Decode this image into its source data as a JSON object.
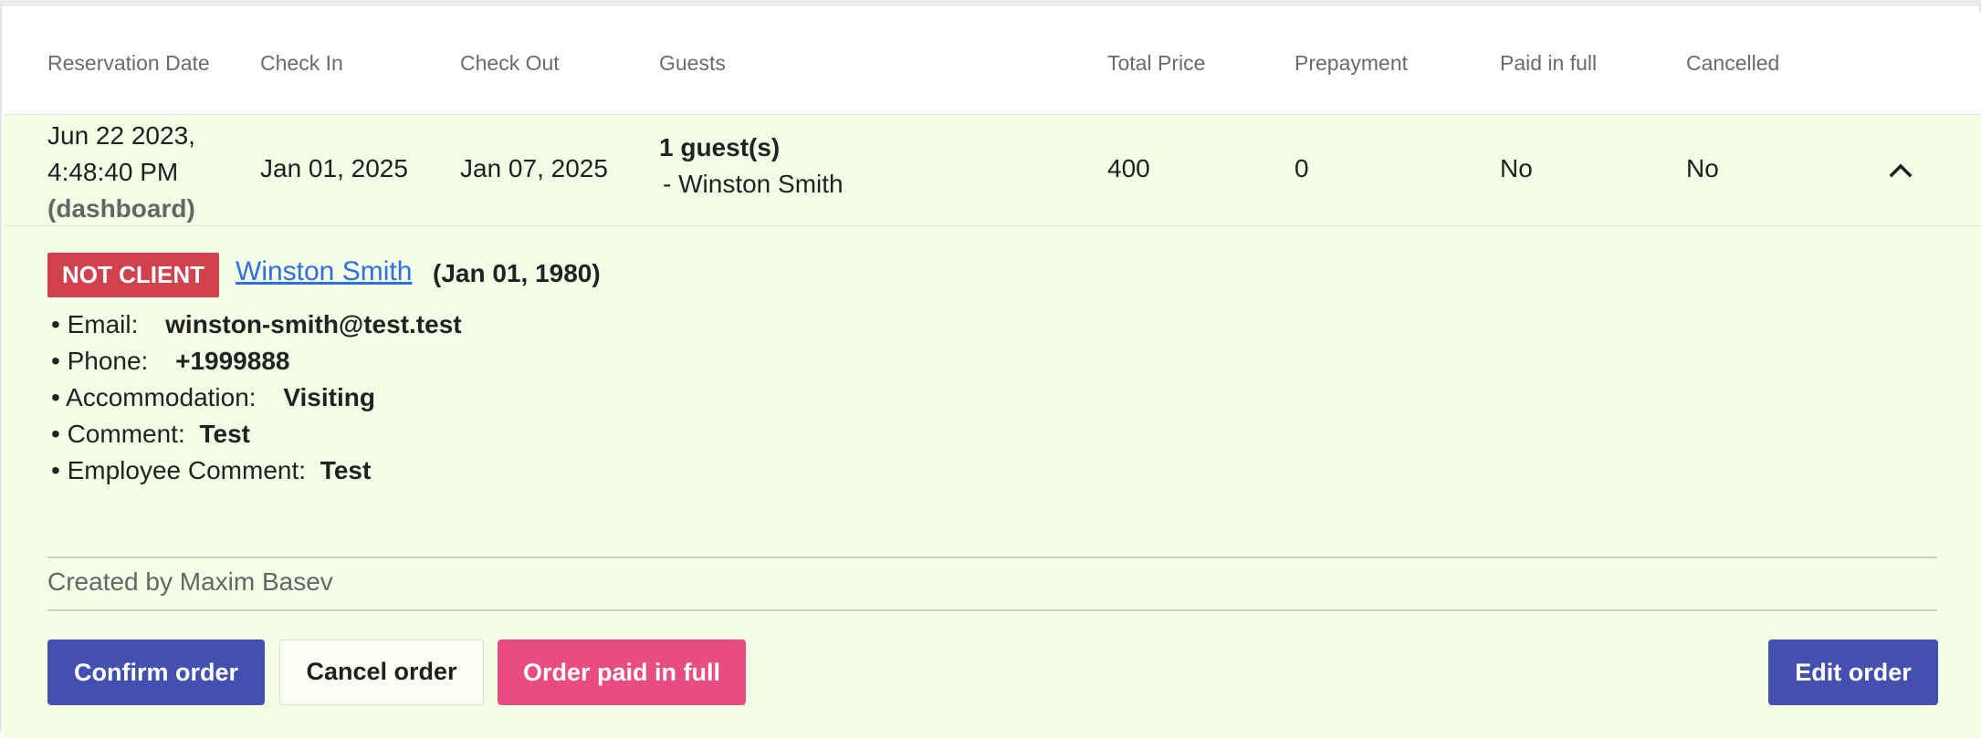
{
  "table": {
    "headers": [
      "Reservation Date",
      "Check In",
      "Check Out",
      "Guests",
      "Total Price",
      "Prepayment",
      "Paid in full",
      "Cancelled"
    ]
  },
  "row": {
    "reservation_date_line1": "Jun 22 2023,",
    "reservation_date_line2": "4:48:40 PM",
    "reservation_source": "(dashboard)",
    "check_in": "Jan 01, 2025",
    "check_out": "Jan 07, 2025",
    "guests_count": "1 guest(s)",
    "guest_name": "- Winston Smith",
    "total_price": "400",
    "prepayment": "0",
    "paid_in_full": "No",
    "cancelled": "No",
    "expand_icon": "chevron-up-icon"
  },
  "details": {
    "badge": "NOT CLIENT",
    "client_name": "Winston Smith",
    "client_dob": "(Jan 01, 1980)",
    "email_label": "• Email:",
    "email": "winston-smith@test.test",
    "phone_label": "• Phone:",
    "phone": "+1999888",
    "accommodation_label": "• Accommodation:",
    "accommodation": "Visiting",
    "comment_label": "• Comment:",
    "comment": "Test",
    "employee_comment_label": "• Employee Comment:",
    "employee_comment": "Test",
    "created_by": "Created by Maxim Basev"
  },
  "actions": {
    "confirm": "Confirm order",
    "cancel": "Cancel order",
    "paid": "Order paid in full",
    "edit": "Edit order"
  },
  "colors": {
    "row_bg": "#f4fde6",
    "badge_bg": "#d0434e",
    "primary": "#4450b0",
    "pink": "#e84c83",
    "link": "#2f6fe0"
  }
}
